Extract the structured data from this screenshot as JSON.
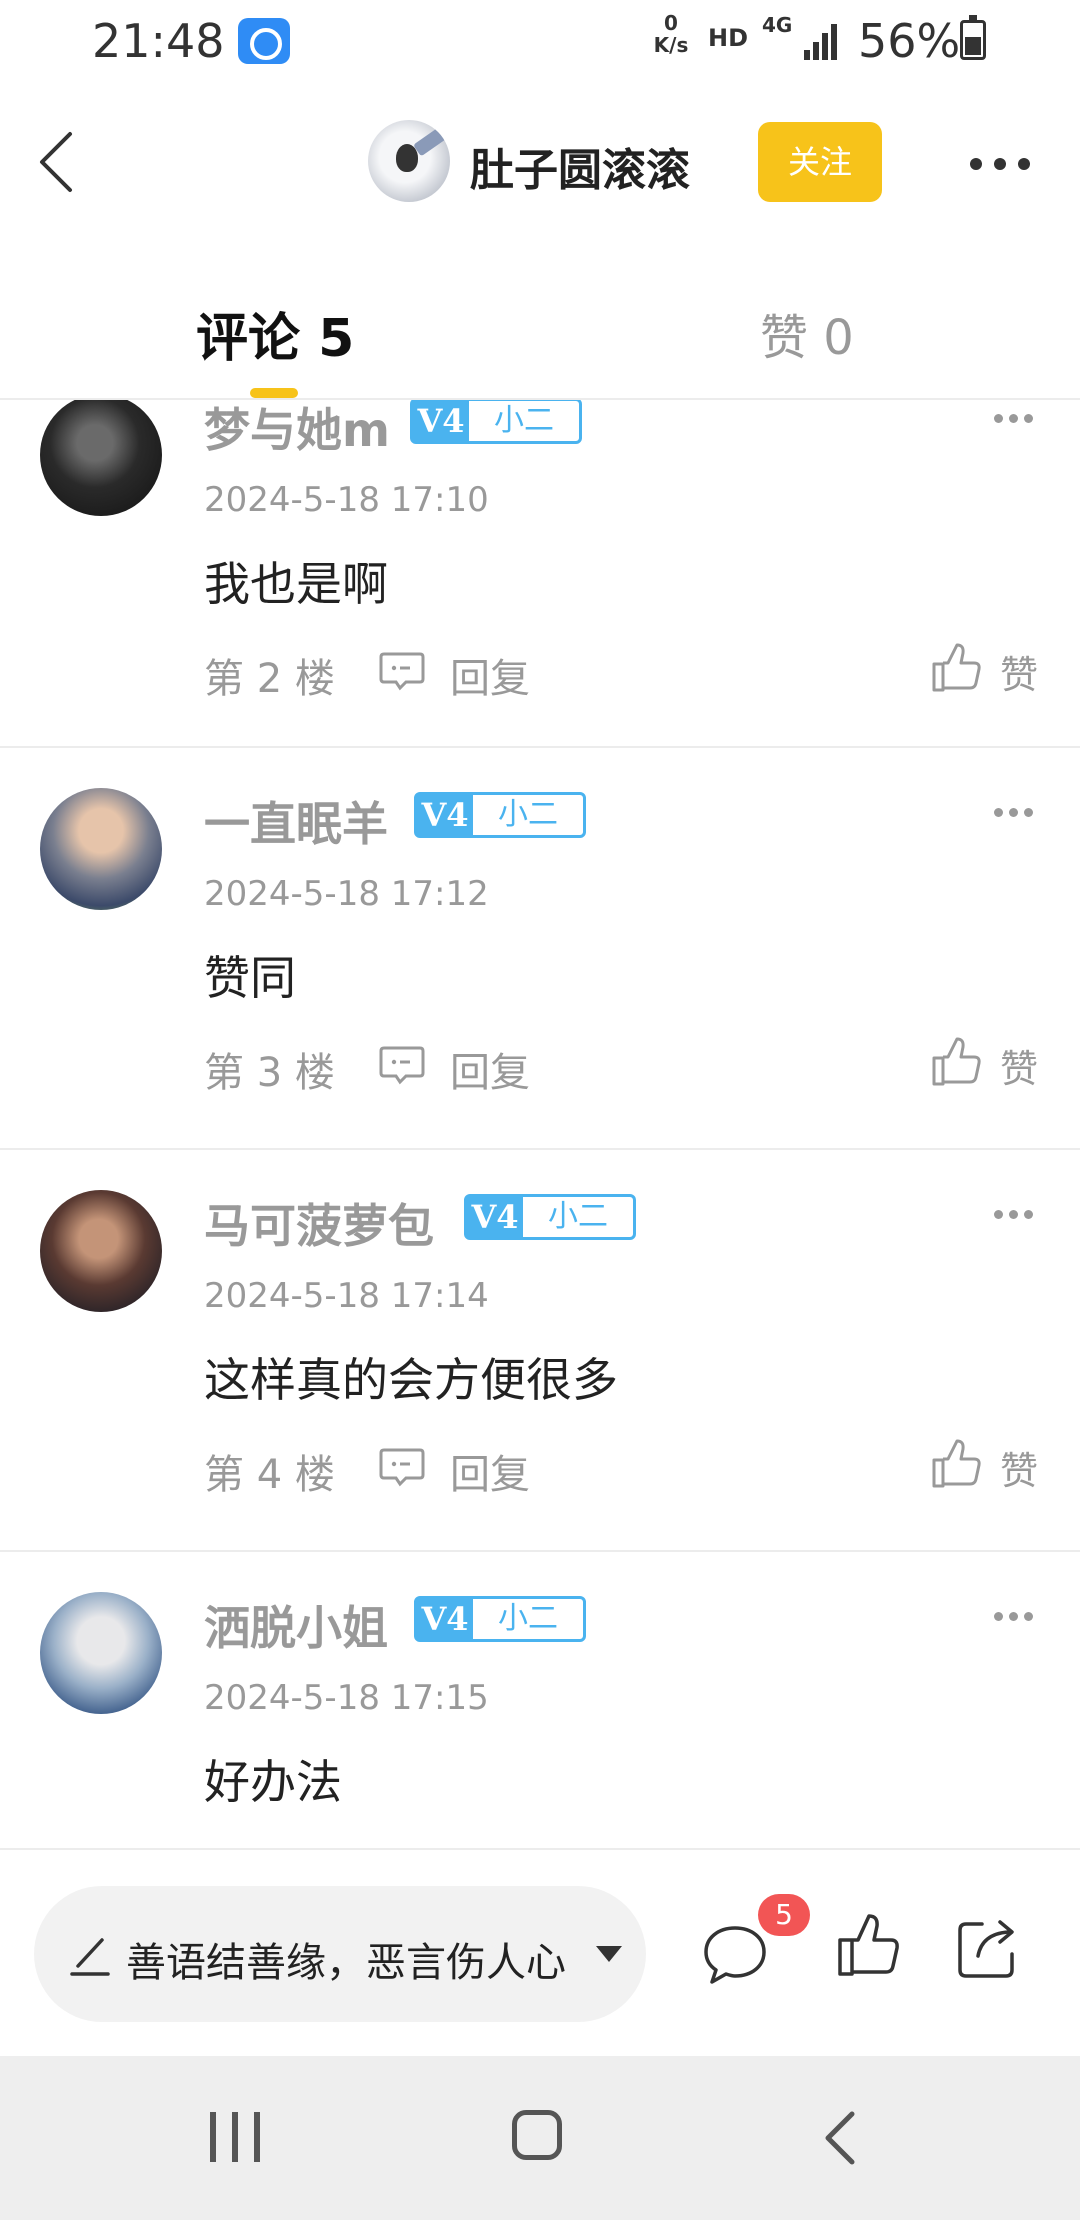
{
  "status_bar": {
    "time": "21:48",
    "net_speed_value": "0",
    "net_speed_unit": "K/s",
    "hd": "HD",
    "network": "4G",
    "battery": "56%"
  },
  "header": {
    "author_name": "肚子圆滚滚",
    "follow_label": "关注"
  },
  "tabs": {
    "comments_label": "评论 5",
    "likes_label": "赞 0"
  },
  "level_badge": {
    "level": "V4",
    "rank": "小二",
    "color": "#4ab3ef"
  },
  "comments": [
    {
      "username": "梦与她m",
      "time": "2024-5-18 17:10",
      "text": "我也是啊",
      "floor": "第 2 楼",
      "reply_label": "回复",
      "like_label": "赞"
    },
    {
      "username": "一直眠羊",
      "time": "2024-5-18 17:12",
      "text": "赞同",
      "floor": "第 3 楼",
      "reply_label": "回复",
      "like_label": "赞"
    },
    {
      "username": "马可菠萝包",
      "time": "2024-5-18 17:14",
      "text": "这样真的会方便很多",
      "floor": "第 4 楼",
      "reply_label": "回复",
      "like_label": "赞"
    },
    {
      "username": "洒脱小姐",
      "time": "2024-5-18 17:15",
      "text": "好办法",
      "floor": "",
      "reply_label": "",
      "like_label": ""
    }
  ],
  "bottom_bar": {
    "input_placeholder": "善语结善缘，恶言伤人心",
    "comment_count": "5"
  },
  "colors": {
    "accent_yellow": "#f7c31a",
    "badge_red": "#f25555",
    "secondary_text": "#999999"
  }
}
